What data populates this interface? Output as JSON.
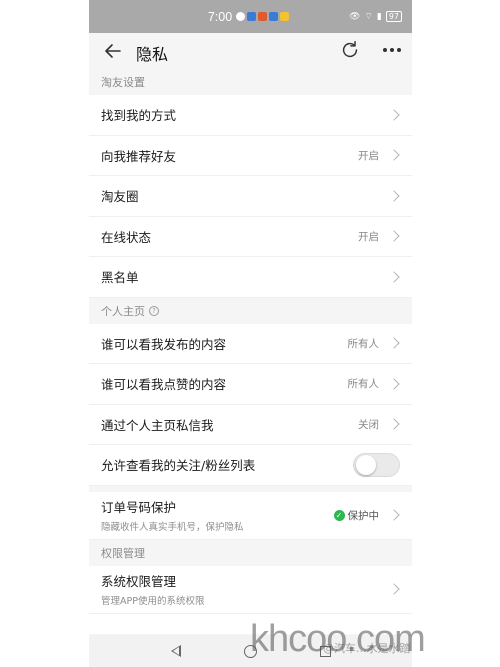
{
  "status_bar": {
    "time": "7:00",
    "battery": "97"
  },
  "header": {
    "title": "隐私"
  },
  "sections": {
    "taoyou": {
      "title": "淘友设置",
      "rows": [
        {
          "label": "找到我的方式",
          "value": ""
        },
        {
          "label": "向我推荐好友",
          "value": "开启"
        },
        {
          "label": "淘友圈",
          "value": ""
        },
        {
          "label": "在线状态",
          "value": "开启"
        },
        {
          "label": "黑名单",
          "value": ""
        }
      ]
    },
    "homepage": {
      "title": "个人主页",
      "rows": [
        {
          "label": "谁可以看我发布的内容",
          "value": "所有人"
        },
        {
          "label": "谁可以看我点赞的内容",
          "value": "所有人"
        },
        {
          "label": "通过个人主页私信我",
          "value": "关闭"
        }
      ],
      "toggle_row": {
        "label": "允许查看我的关注/粉丝列表",
        "enabled": false
      }
    },
    "order": {
      "label": "订单号码保护",
      "sub": "隐藏收件人真实手机号，保护隐私",
      "status": "保护中"
    },
    "permission": {
      "title": "权限管理",
      "rows": [
        {
          "label": "系统权限管理",
          "sub": "管理APP使用的系统权限"
        }
      ]
    }
  },
  "watermark": {
    "main": "khcoo.com",
    "sub": "@汽车...水是水踏"
  },
  "colors": {
    "status_bar_bg": "#a9a9a9",
    "protect_green": "#2db84d"
  }
}
